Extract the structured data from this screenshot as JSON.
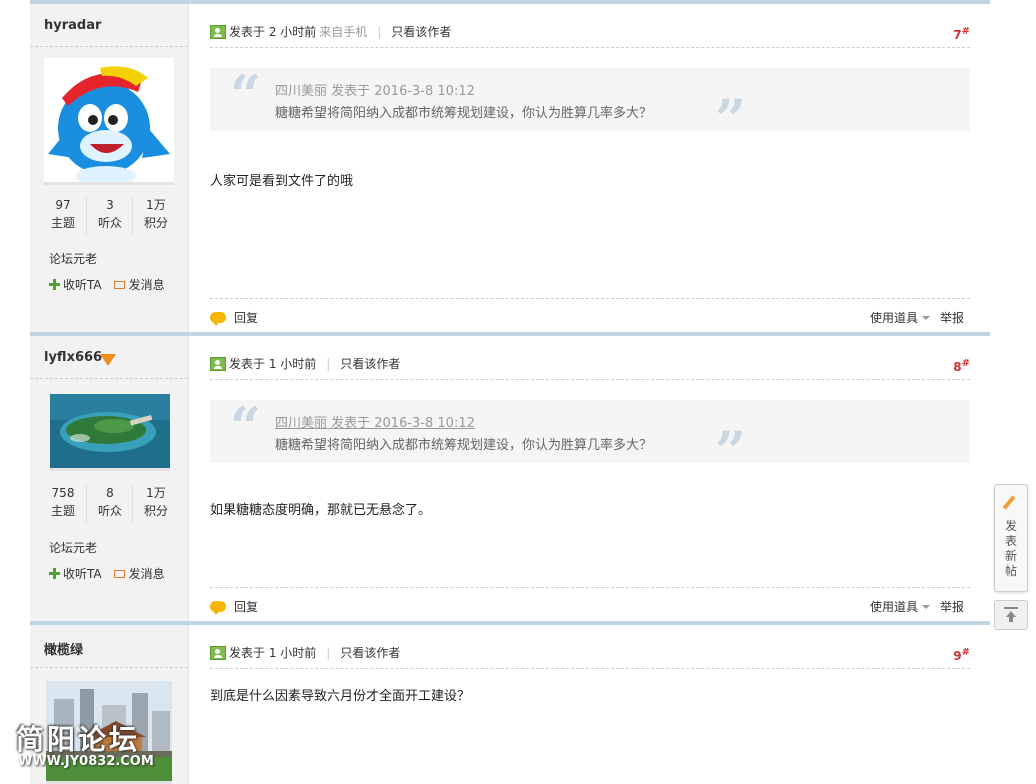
{
  "posts": [
    {
      "username": "hyradar",
      "stats": [
        {
          "value": "97",
          "label": "主题"
        },
        {
          "value": "3",
          "label": "听众"
        },
        {
          "value": "1万",
          "label": "积分"
        }
      ],
      "rank": "论坛元老",
      "follow_label": "收听TA",
      "message_label": "发消息",
      "posted": "发表于 2 小时前",
      "from": "来自手机",
      "only_author": "只看该作者",
      "floor": "7",
      "floor_mark": "#",
      "quote_author": "四川美丽 发表于 2016-3-8 10:12",
      "quote_text": "糖糖希望将简阳纳入成都市统筹规划建设，你认为胜算几率多大？",
      "message": "人家可是看到文件了的哦",
      "reply_label": "回复",
      "tools_label": "使用道具",
      "report_label": "举报"
    },
    {
      "username": "lyflx666",
      "stats": [
        {
          "value": "758",
          "label": "主题"
        },
        {
          "value": "8",
          "label": "听众"
        },
        {
          "value": "1万",
          "label": "积分"
        }
      ],
      "rank": "论坛元老",
      "follow_label": "收听TA",
      "message_label": "发消息",
      "posted": "发表于 1 小时前",
      "only_author": "只看该作者",
      "floor": "8",
      "floor_mark": "#",
      "quote_author": "四川美丽 发表于 2016-3-8 10:12",
      "quote_text": "糖糖希望将简阳纳入成都市统筹规划建设，你认为胜算几率多大？",
      "message": "如果糖糖态度明确，那就已无悬念了。",
      "reply_label": "回复",
      "tools_label": "使用道具",
      "report_label": "举报"
    },
    {
      "username": "橄榄绿",
      "posted": "发表于 1 小时前",
      "only_author": "只看该作者",
      "floor": "9",
      "floor_mark": "#",
      "message": "到底是什么因素导致六月份才全面开工建设？"
    }
  ],
  "side_tools": {
    "new_post_label": "发表新帖"
  },
  "watermark": {
    "name": "简阳论坛",
    "url": "WWW.JY0832.COM"
  },
  "colors": {
    "post_border": "#c2d5e3",
    "sidebar_bg": "#f2f2f2",
    "floor": "#cc3333",
    "vip_badge": "#f08d1c"
  }
}
